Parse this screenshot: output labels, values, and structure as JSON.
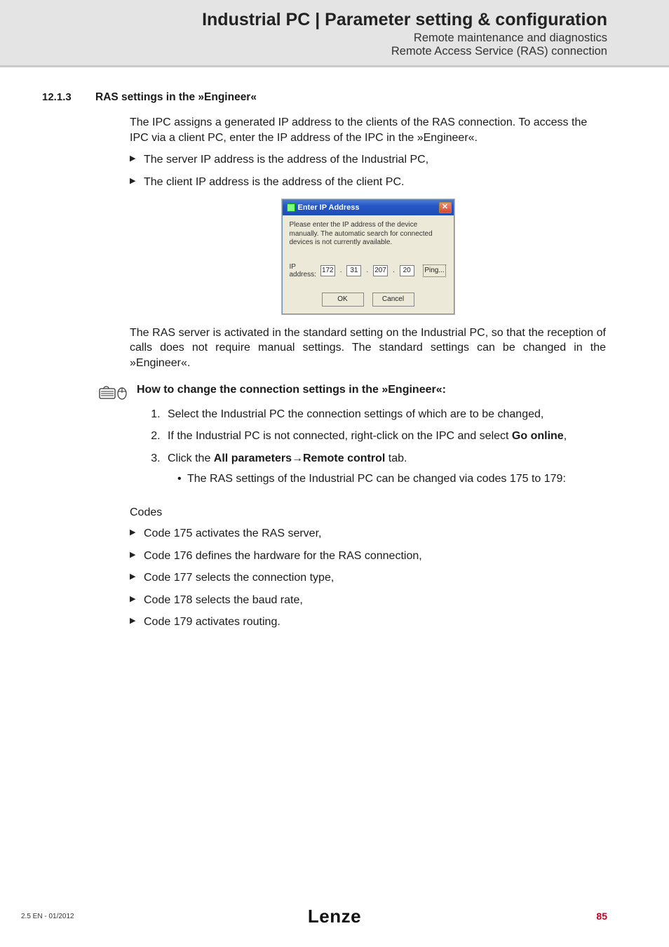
{
  "header": {
    "title": "Industrial PC | Parameter setting & configuration",
    "sub1": "Remote maintenance and diagnostics",
    "sub2": "Remote Access Service (RAS) connection"
  },
  "section": {
    "num": "12.1.3",
    "title": "RAS settings in the »Engineer«"
  },
  "intro": "The IPC assigns a generated IP address to the clients of the RAS connection. To access the IPC via a client PC, enter the IP address of the IPC in the »Engineer«.",
  "points": [
    "The server IP address is the address of the Industrial PC,",
    "The client IP address is the address of the client PC."
  ],
  "dialog": {
    "title": "Enter IP Address",
    "close": "✕",
    "message": "Please enter the IP address of the device manually. The automatic search for connected devices is not currently available.",
    "iplabel": "IP address:",
    "oct1": "172",
    "oct2": "31",
    "oct3": "207",
    "oct4": "20",
    "ping": "Ping...",
    "ok": "OK",
    "cancel": "Cancel"
  },
  "after_dialog": "The RAS server is activated in the standard setting on the Industrial PC, so that the reception of calls does not require manual settings. The standard settings can be changed in the »Engineer«.",
  "howto_title": "How to change the connection settings in the »Engineer«:",
  "steps": {
    "s1": "Select the Industrial PC the connection settings of which are to be changed,",
    "s2_pre": "If the Industrial PC is not connected, right-click on the IPC and select ",
    "s2_b": "Go online",
    "s2_post": ",",
    "s3_pre": "Click the ",
    "s3_b": "All parameters→Remote control",
    "s3_post": " tab.",
    "s3_sub": "The RAS settings of the Industrial PC can be changed via codes 175 to 179:"
  },
  "codes_title": "Codes",
  "codes": [
    "Code 175 activates the RAS server,",
    "Code 176 defines the hardware for the RAS connection,",
    "Code 177 selects the connection type,",
    "Code 178 selects the baud rate,",
    "Code 179 activates routing."
  ],
  "footer": {
    "left": "2.5 EN - 01/2012",
    "logo": "Lenze",
    "page": "85"
  }
}
